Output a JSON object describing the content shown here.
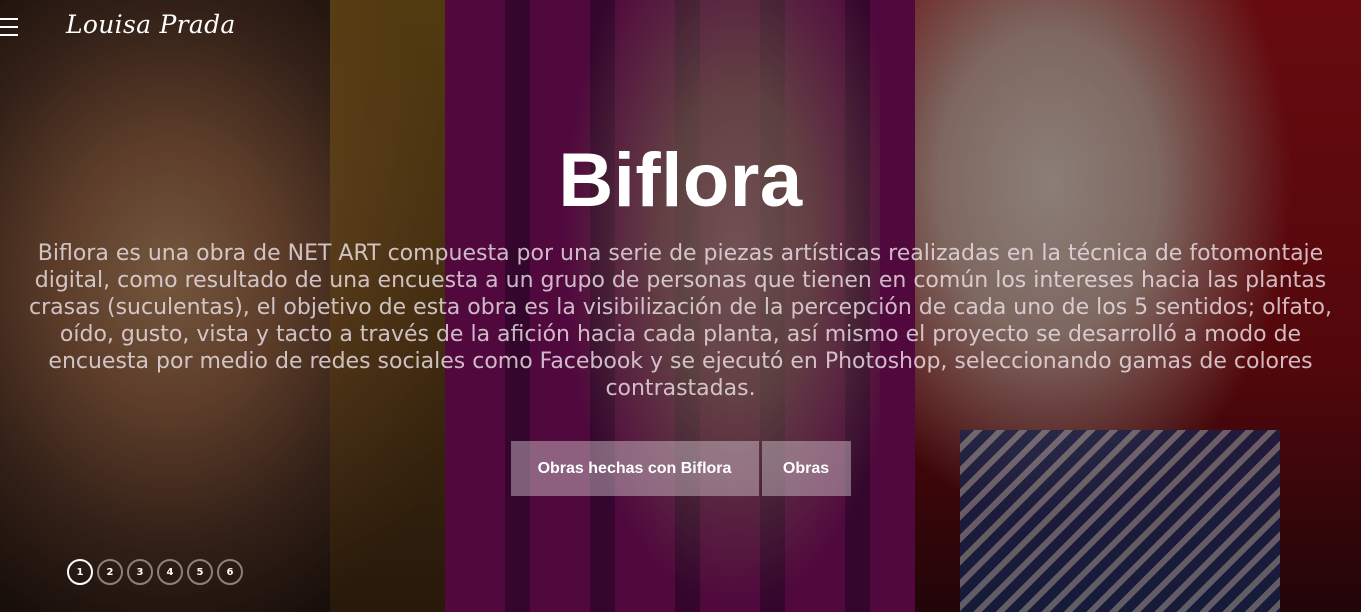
{
  "header": {
    "brand": "Louisa Prada",
    "menu_icon": "hamburger-menu-icon"
  },
  "hero": {
    "title": "Biflora",
    "description": "Biflora es una obra de NET ART compuesta por una serie de piezas artísticas realizadas en la técnica de fotomontaje digital, como resultado de una encuesta a un grupo de personas que tienen en común los intereses hacia las plantas crasas (suculentas), el objetivo de esta obra es la visibilización de la percepción de cada uno de los 5 sentidos; olfato, oído, gusto, vista y tacto a través de la afición hacia cada planta, así mismo el proyecto se desarrolló a modo de encuesta por medio de redes sociales como Facebook y se ejecutó en Photoshop, seleccionando gamas de colores contrastadas.",
    "buttons": {
      "primary": "Obras hechas con Biflora",
      "secondary": "Obras"
    }
  },
  "pagination": {
    "pages": [
      "1",
      "2",
      "3",
      "4",
      "5",
      "6"
    ],
    "active": "1"
  },
  "colors": {
    "overlay": "#000000",
    "button_bg": "#d7cdd2",
    "text": "#ffffff"
  }
}
